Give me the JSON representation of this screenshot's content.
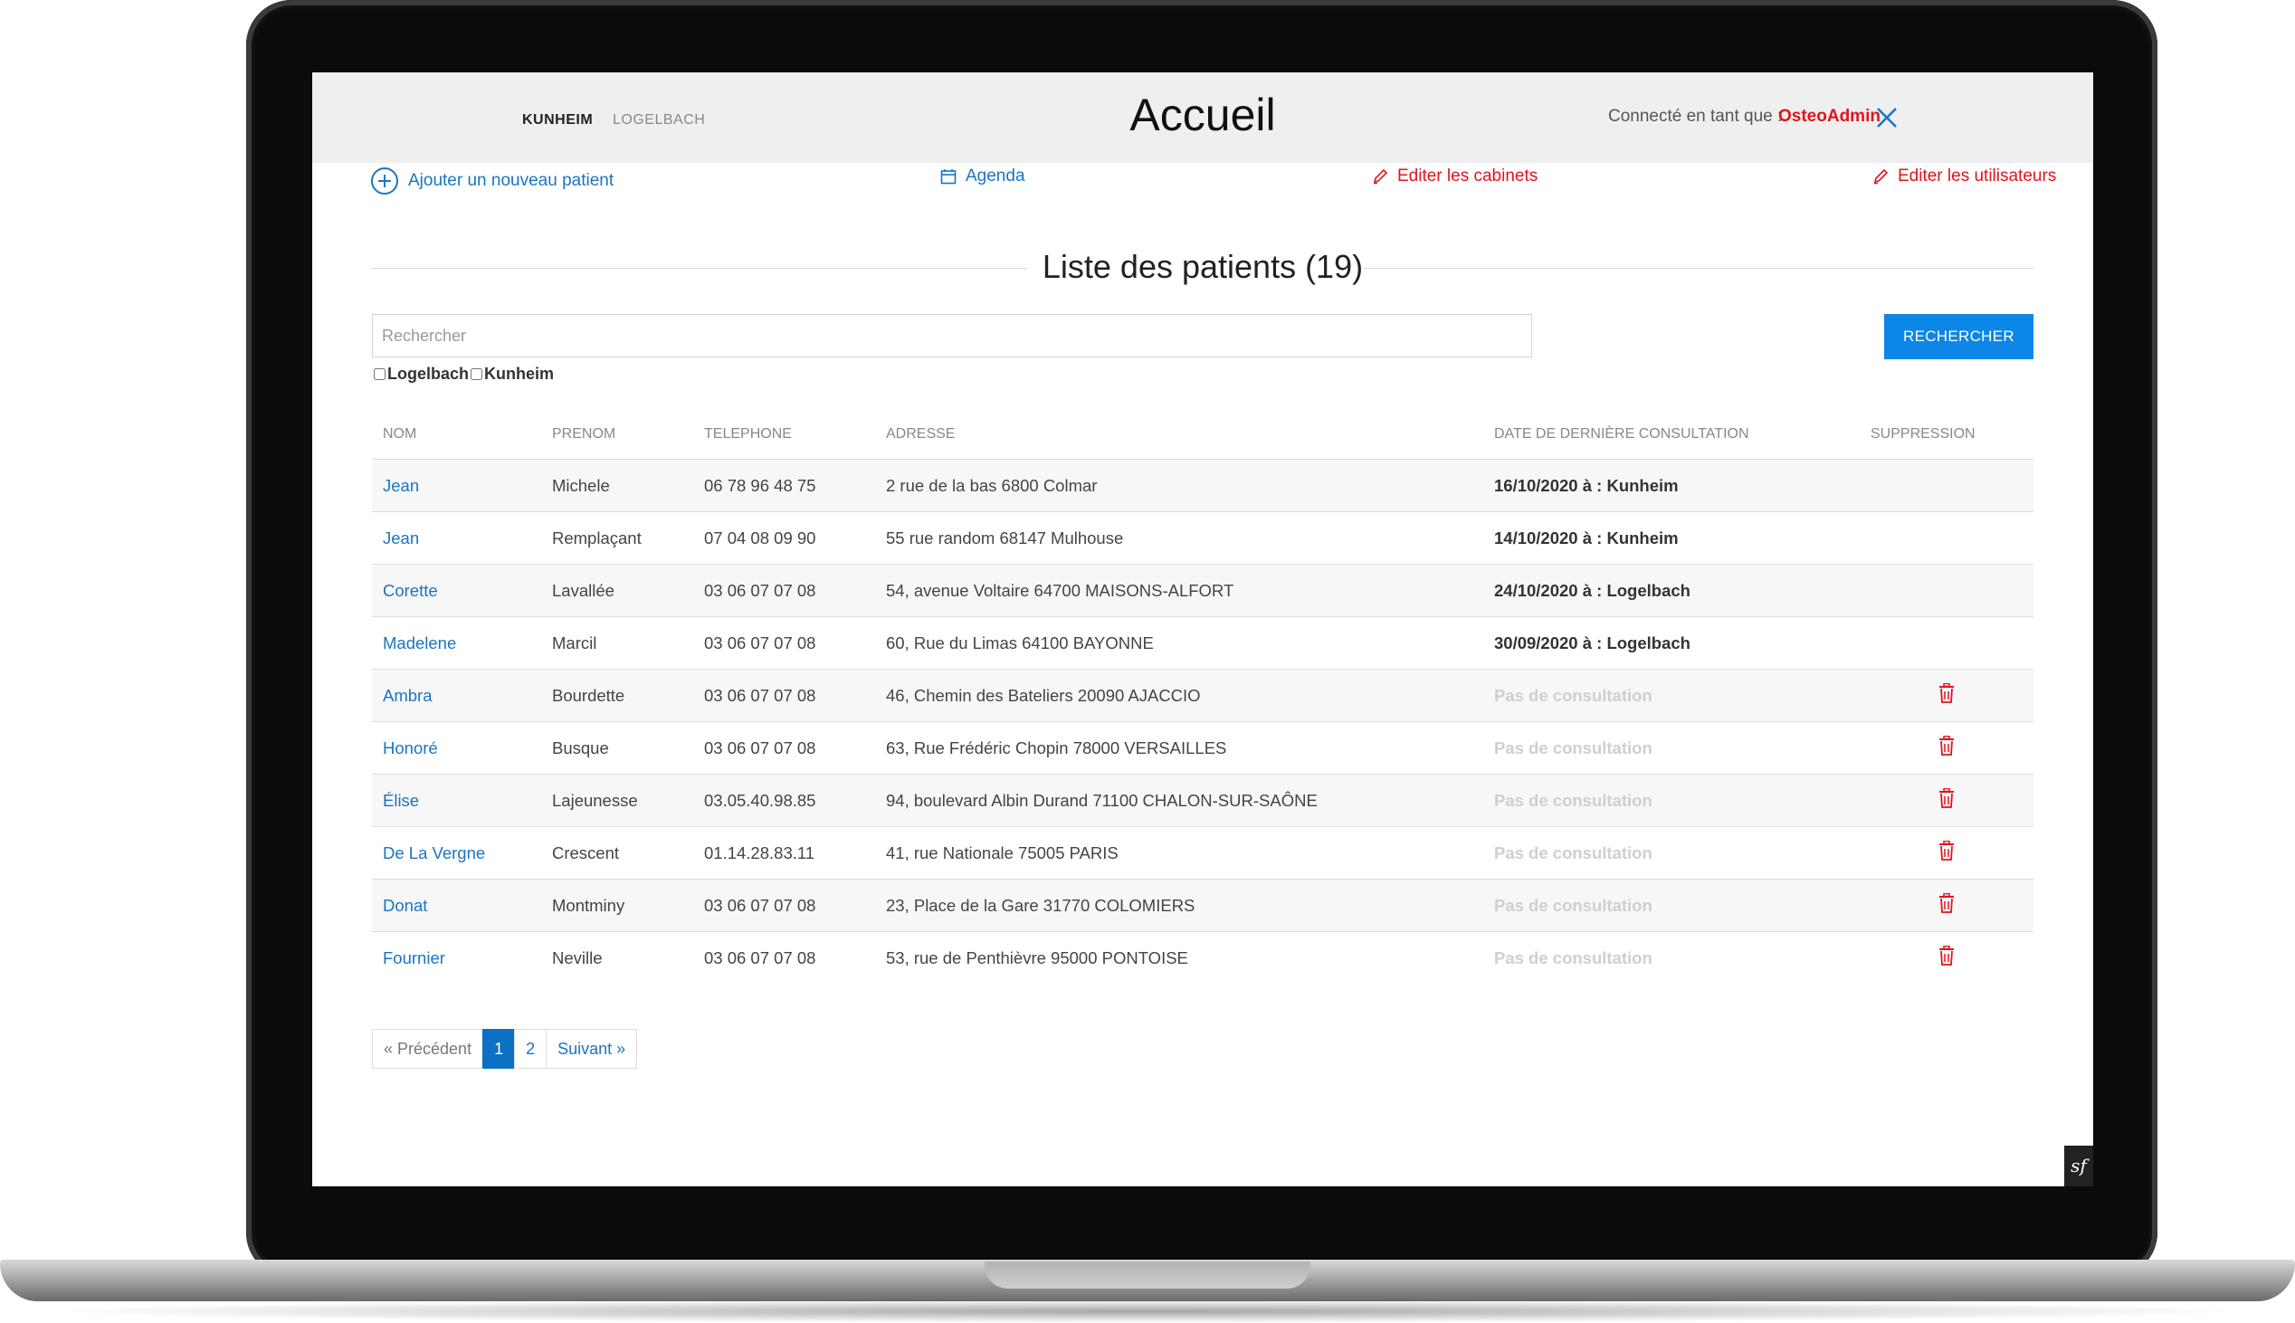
{
  "header": {
    "cabinets": [
      "KUNHEIM",
      "LOGELBACH"
    ],
    "title": "Accueil",
    "connected_label": "Connecté en tant que :",
    "username": "OsteoAdmin"
  },
  "actions": {
    "add_patient": "Ajouter un nouveau patient",
    "agenda": "Agenda",
    "edit_cabinets": "Editer les cabinets",
    "edit_users": "Editer les utilisateurs"
  },
  "list": {
    "title": "Liste des patients (19)",
    "search_placeholder": "Rechercher",
    "search_button": "RECHERCHER",
    "filters": [
      "Logelbach",
      "Kunheim"
    ]
  },
  "table": {
    "columns": [
      "NOM",
      "PRENOM",
      "TELEPHONE",
      "ADRESSE",
      "DATE DE DERNIÈRE CONSULTATION",
      "SUPPRESSION"
    ],
    "rows": [
      {
        "nom": "Jean",
        "prenom": "Michele",
        "telephone": "06 78 96 48 75",
        "adresse": "2 rue de la bas 6800 Colmar",
        "date": "16/10/2020 à : Kunheim",
        "has_consultation": true
      },
      {
        "nom": "Jean",
        "prenom": "Remplaçant",
        "telephone": "07 04 08 09 90",
        "adresse": "55 rue random 68147 Mulhouse",
        "date": "14/10/2020 à : Kunheim",
        "has_consultation": true
      },
      {
        "nom": "Corette",
        "prenom": "Lavallée",
        "telephone": "03 06 07 07 08",
        "adresse": "54, avenue Voltaire 64700 MAISONS-ALFORT",
        "date": "24/10/2020 à : Logelbach",
        "has_consultation": true
      },
      {
        "nom": "Madelene",
        "prenom": "Marcil",
        "telephone": "03 06 07 07 08",
        "adresse": "60, Rue du Limas 64100 BAYONNE",
        "date": "30/09/2020 à : Logelbach",
        "has_consultation": true
      },
      {
        "nom": "Ambra",
        "prenom": "Bourdette",
        "telephone": "03 06 07 07 08",
        "adresse": "46, Chemin des Bateliers 20090 AJACCIO",
        "date": "Pas de consultation",
        "has_consultation": false
      },
      {
        "nom": "Honoré",
        "prenom": "Busque",
        "telephone": "03 06 07 07 08",
        "adresse": "63, Rue Frédéric Chopin 78000 VERSAILLES",
        "date": "Pas de consultation",
        "has_consultation": false
      },
      {
        "nom": "Élise",
        "prenom": "Lajeunesse",
        "telephone": "03.05.40.98.85",
        "adresse": "94, boulevard Albin Durand 71100 CHALON-SUR-SAÔNE",
        "date": "Pas de consultation",
        "has_consultation": false
      },
      {
        "nom": "De La Vergne",
        "prenom": "Crescent",
        "telephone": "01.14.28.83.11",
        "adresse": "41, rue Nationale 75005 PARIS",
        "date": "Pas de consultation",
        "has_consultation": false
      },
      {
        "nom": "Donat",
        "prenom": "Montminy",
        "telephone": "03 06 07 07 08",
        "adresse": "23, Place de la Gare 31770 COLOMIERS",
        "date": "Pas de consultation",
        "has_consultation": false
      },
      {
        "nom": "Fournier",
        "prenom": "Neville",
        "telephone": "03 06 07 07 08",
        "adresse": "53, rue de Penthièvre 95000 PONTOISE",
        "date": "Pas de consultation",
        "has_consultation": false
      }
    ]
  },
  "pagination": {
    "prev": "« Précédent",
    "pages": [
      "1",
      "2"
    ],
    "current": "1",
    "next": "Suivant »"
  },
  "colors": {
    "link_blue": "#1a74c4",
    "danger_red": "#e0141e",
    "button_blue": "#0c87e8"
  },
  "icons": {
    "add": "plus-circle-icon",
    "agenda": "calendar-icon",
    "edit": "pencil-icon",
    "logout": "close-icon",
    "delete": "trash-icon"
  }
}
